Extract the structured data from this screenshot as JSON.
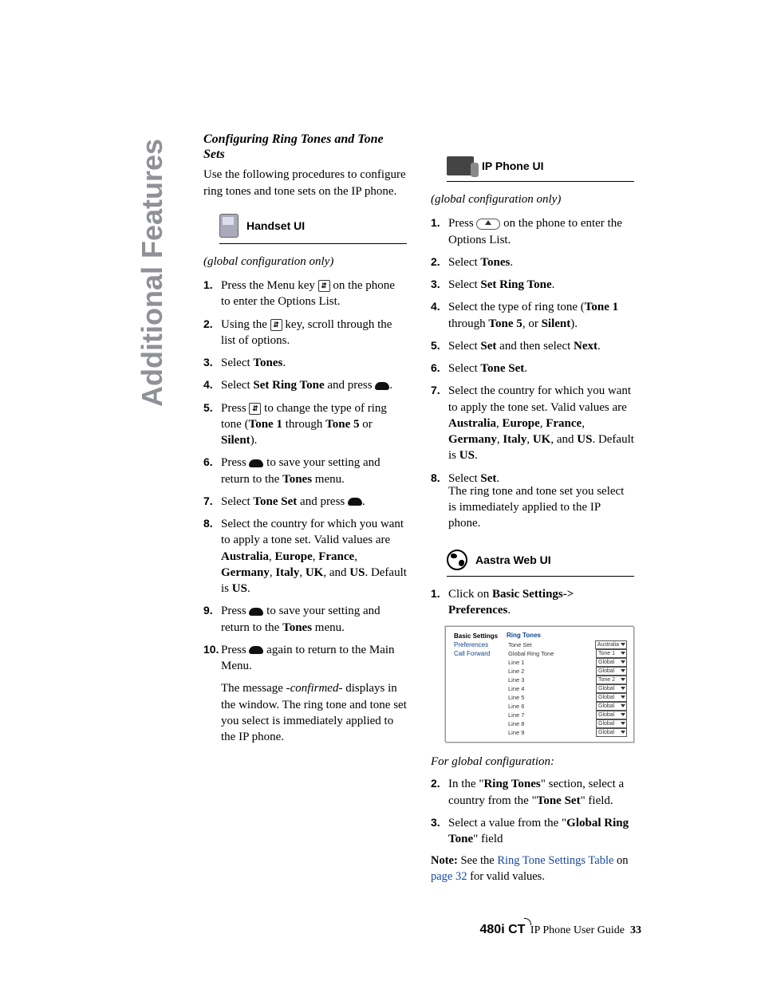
{
  "side_tab": "Additional Features",
  "section_title": "Configuring Ring Tones and Tone Sets",
  "intro": "Use the following procedures to configure ring tones and tone sets on the IP phone.",
  "handset": {
    "label": "Handset UI",
    "note": "(global configuration only)",
    "steps": {
      "s1a": "Press the Menu key ",
      "s1b": " on the phone to enter the Options List.",
      "s2a": "Using the ",
      "s2b": " key, scroll through the list of options.",
      "s3a": "Select ",
      "s3b": "Tones",
      "s3c": ".",
      "s4a": "Select ",
      "s4b": "Set Ring Tone",
      "s4c": " and press ",
      "s5a": "Press ",
      "s5b": " to change the type of ring tone (",
      "s5c": "Tone 1",
      "s5d": " through ",
      "s5e": "Tone 5",
      "s5f": " or ",
      "s5g": "Silent",
      "s5h": ").",
      "s6a": "Press ",
      "s6b": " to save your setting and return to the ",
      "s6c": "Tones",
      "s6d": " menu.",
      "s7a": "Select ",
      "s7b": "Tone Set",
      "s7c": " and press ",
      "s8a": "Select the country for which you want to apply a tone set. Valid values are ",
      "s8b": "Australia",
      "s8c": "Europe",
      "s8d": "France",
      "s8e": "Germany",
      "s8f": "Italy",
      "s8g": "UK",
      "s8h": "US",
      "s8i": ". Default is ",
      "s8j": "US",
      "s8k": ".",
      "s9a": "Press ",
      "s9b": " to save your setting and return to the ",
      "s9c": "Tones",
      "s9d": " menu.",
      "s10a": "Press ",
      "s10b": " again to return to the Main Menu."
    },
    "confirm": "The message -confirmed- displays in the window. The ring tone and tone set you select is immediately applied to the IP phone.",
    "confirm_em": "-confirmed-"
  },
  "ipphone": {
    "label": "IP Phone UI",
    "note": "(global configuration only)",
    "steps": {
      "s1a": "Press ",
      "s1b": " on the phone to enter the Options List.",
      "s2a": "Select ",
      "s2b": "Tones",
      "s2c": ".",
      "s3a": "Select ",
      "s3b": "Set Ring Tone",
      "s3c": ".",
      "s4a": "Select the type of ring tone (",
      "s4b": "Tone 1",
      "s4c": " through ",
      "s4d": "Tone 5",
      "s4e": ", or ",
      "s4f": "Silent",
      "s4g": ").",
      "s5a": "Select ",
      "s5b": "Set",
      "s5c": " and then select ",
      "s5d": "Next",
      "s5e": ".",
      "s6a": "Select ",
      "s6b": "Tone Set",
      "s6c": ".",
      "s7a": "Select the country for which you want to apply the tone set. Valid values are ",
      "s7b": "Australia",
      "s7c": "Europe",
      "s7d": "France",
      "s7e": "Germany",
      "s7f": "Italy",
      "s7g": "UK",
      "s7h": "US",
      "s7i": ". Default is ",
      "s7j": "US",
      "s7k": ".",
      "s8a": "Select ",
      "s8b": "Set",
      "s8c": ".",
      "s8tail": "The ring tone and tone set you select is immediately applied to the IP phone."
    }
  },
  "web": {
    "label": "Aastra Web UI",
    "step1a": "Click on ",
    "step1b": "Basic Settings-> Preferences",
    "step1c": ".",
    "shot": {
      "side_head": "Basic Settings",
      "side_items": [
        "Preferences",
        "Call Forward"
      ],
      "main_head": "Ring Tones",
      "rows": [
        {
          "label": "Tone Set",
          "value": "Australia"
        },
        {
          "label": "Global Ring Tone",
          "value": "Tone 1"
        },
        {
          "label": "Line 1",
          "value": "Global"
        },
        {
          "label": "Line 2",
          "value": "Global"
        },
        {
          "label": "Line 3",
          "value": "Tone 2"
        },
        {
          "label": "Line 4",
          "value": "Global"
        },
        {
          "label": "Line 5",
          "value": "Global"
        },
        {
          "label": "Line 6",
          "value": "Global"
        },
        {
          "label": "Line 7",
          "value": "Global"
        },
        {
          "label": "Line 8",
          "value": "Global"
        },
        {
          "label": "Line 9",
          "value": "Global"
        }
      ]
    },
    "global_head": "For global configuration:",
    "g2a": "In the \"",
    "g2b": "Ring Tones",
    "g2c": "\" section, select a country from the \"",
    "g2d": "Tone Set",
    "g2e": "\" field.",
    "g3a": "Select a value from the \"",
    "g3b": "Global Ring Tone",
    "g3c": "\" field",
    "note_label": "Note: ",
    "note_a": "See the ",
    "note_link1": "Ring Tone Settings Table",
    "note_b": " on ",
    "note_link2": "page 32",
    "note_c": " for valid values."
  },
  "footer": {
    "model": "480i CT",
    "text": " IP Phone User Guide",
    "page": "33"
  }
}
